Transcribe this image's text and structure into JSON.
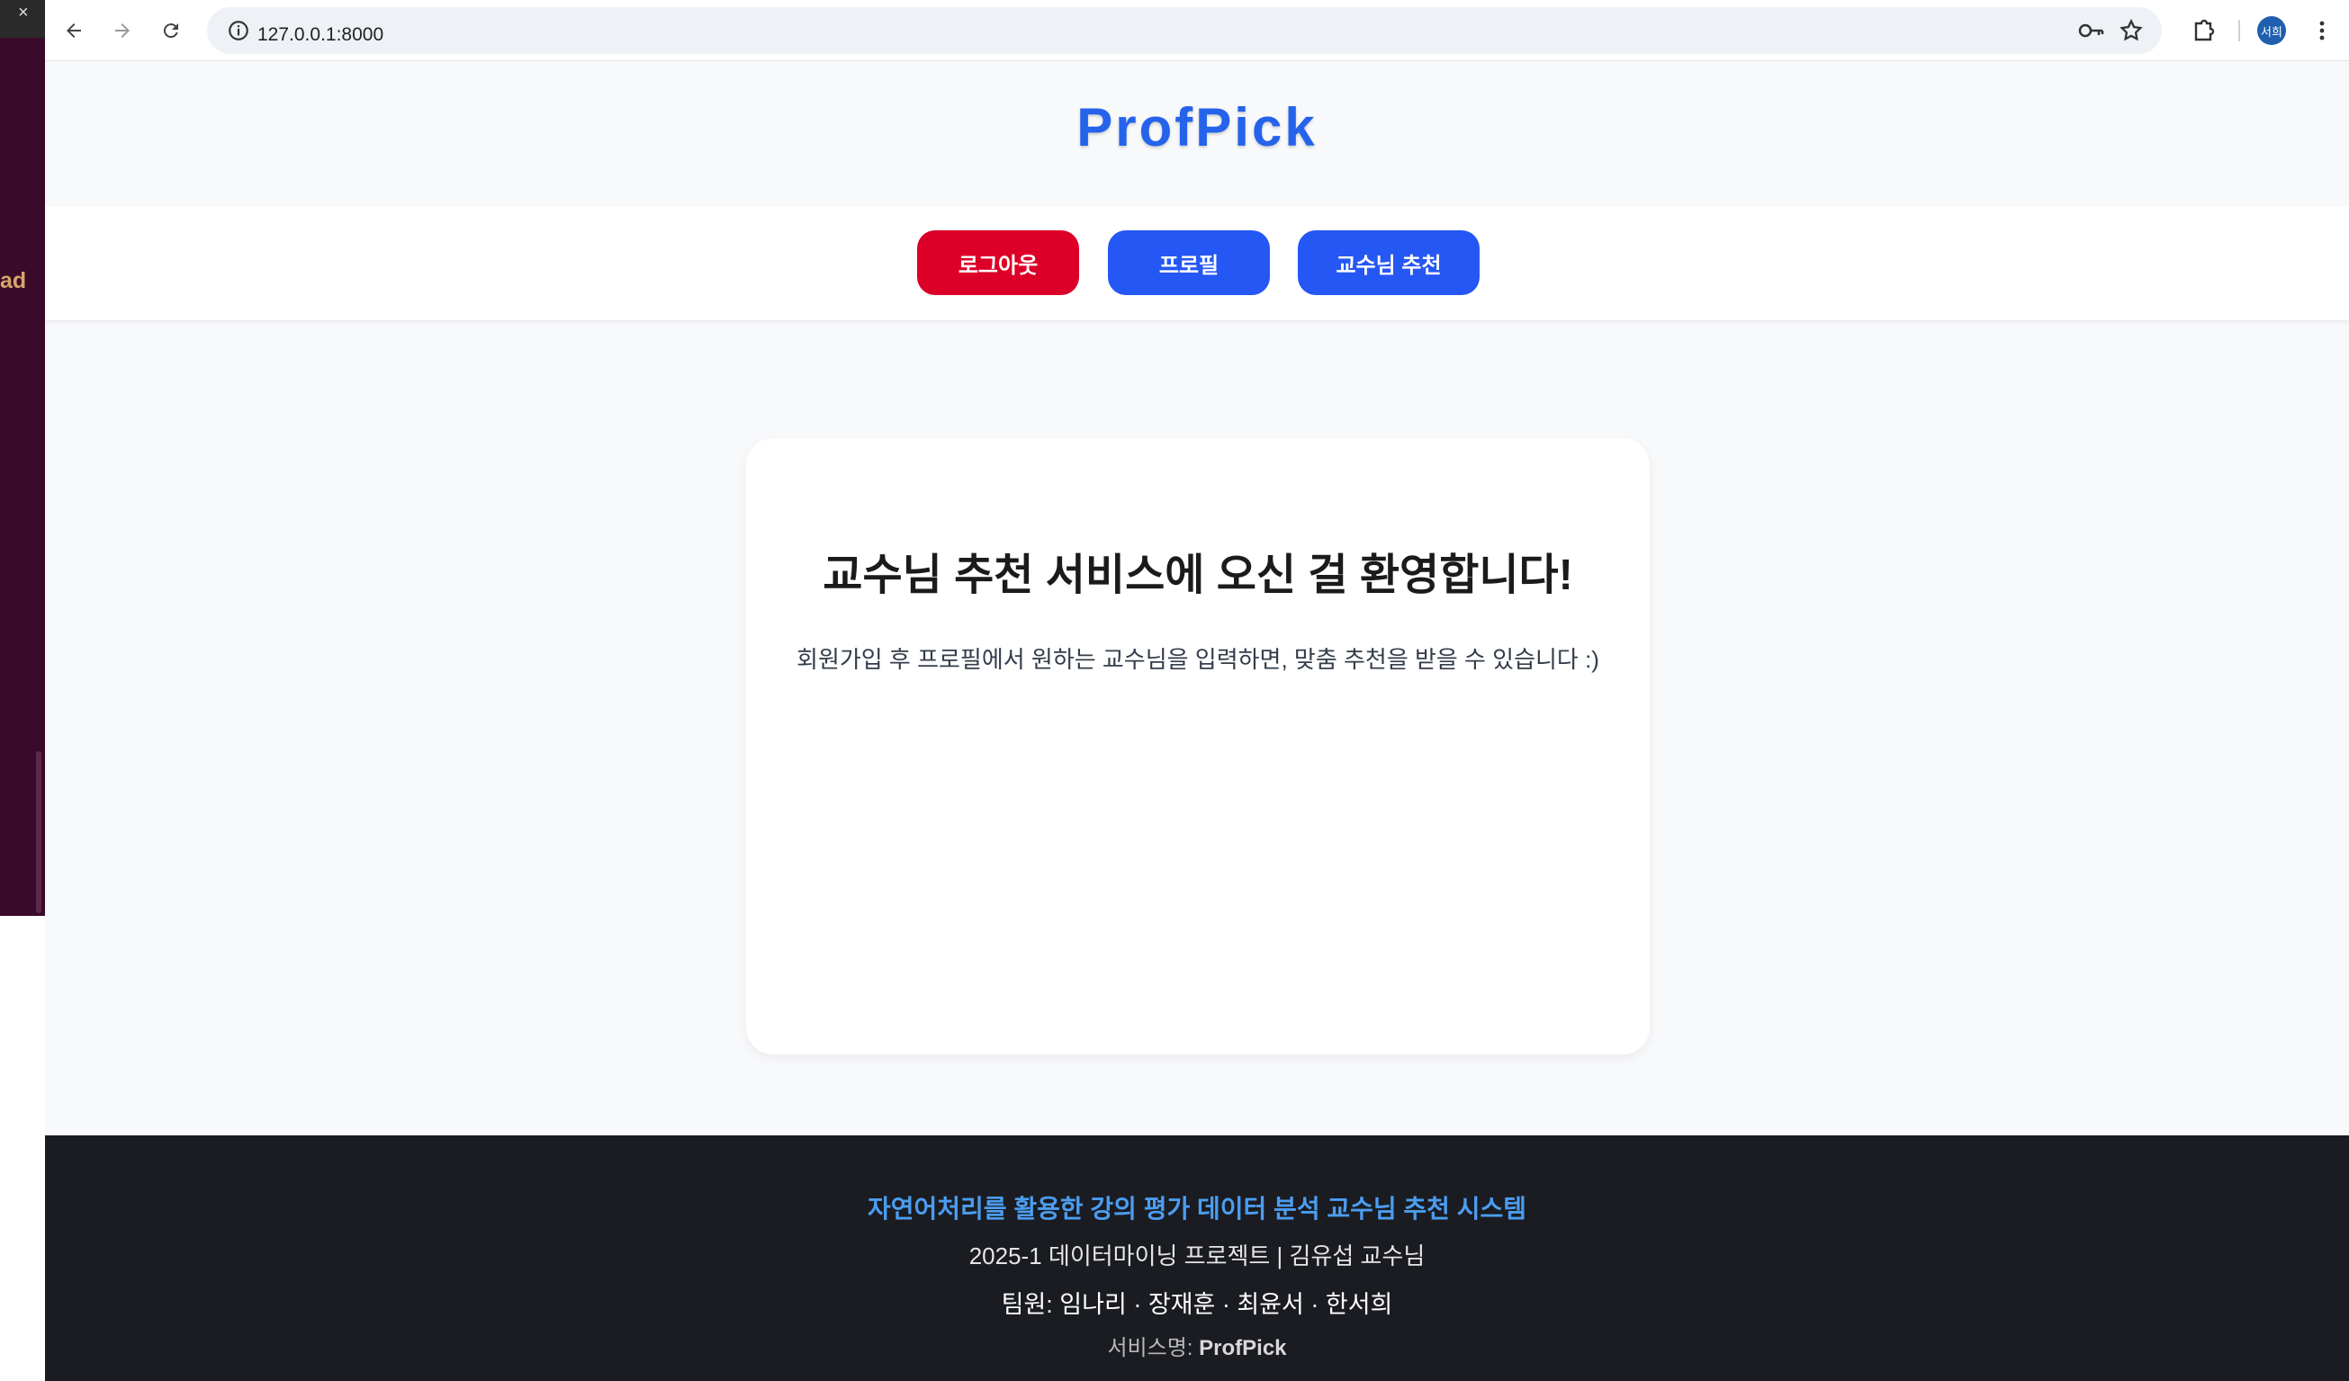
{
  "background_window": {
    "close_glyph": "×",
    "partial_text": "ad"
  },
  "browser": {
    "url": "127.0.0.1:8000",
    "profile_initials": "서희",
    "icons": [
      "back-arrow-icon",
      "forward-arrow-icon",
      "reload-icon",
      "info-icon",
      "password-key-icon",
      "bookmark-star-icon",
      "extensions-icon",
      "kebab-menu-icon"
    ]
  },
  "site": {
    "brand": "ProfPick",
    "nav": {
      "logout_label": "로그아웃",
      "profile_label": "프로필",
      "recommend_label": "교수님 추천"
    },
    "welcome": {
      "title": "교수님 추천 서비스에 오신 걸 환영합니다!",
      "text": "회원가입 후 프로필에서 원하는 교수님을 입력하면, 맞춤 추천을 받을 수 있습니다 :)"
    },
    "footer": {
      "project_title": "자연어처리를 활용한 강의 평가 데이터 분석 교수님 추천 시스템",
      "course_line": "2025-1 데이터마이닝 프로젝트 | 김유섭 교수님",
      "team_line": "팀원: 임나리 · 장재훈 · 최윤서 · 한서희",
      "service_label": "서비스명:",
      "service_name": "ProfPick"
    }
  },
  "colors": {
    "brand": "#2563eb",
    "logout_button": "#dc0028",
    "primary_button": "#2557f5",
    "footer_bg": "#1a1c22",
    "footer_title": "#4c9df0"
  }
}
